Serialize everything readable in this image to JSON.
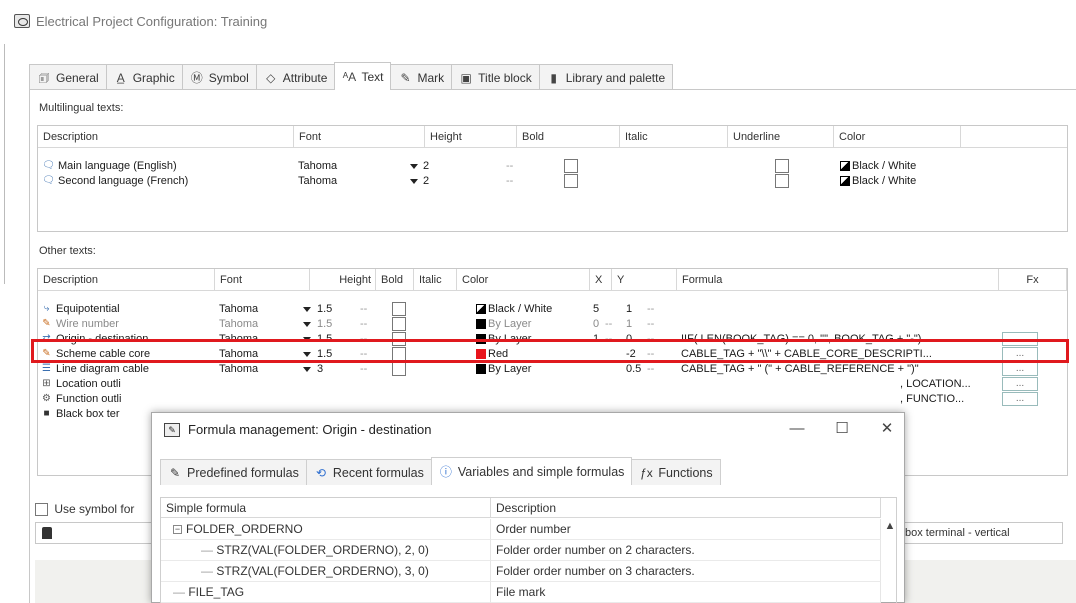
{
  "window": {
    "title": "Electrical Project Configuration: Training"
  },
  "tabs": [
    {
      "label": "General",
      "icon": "general-icon",
      "glyph": "🗊"
    },
    {
      "label": "Graphic",
      "icon": "graphic-icon",
      "glyph": "A̲"
    },
    {
      "label": "Symbol",
      "icon": "symbol-icon",
      "glyph": "Ⓜ"
    },
    {
      "label": "Attribute",
      "icon": "attribute-icon",
      "glyph": "◇"
    },
    {
      "label": "Text",
      "icon": "text-icon",
      "glyph": "ᴬA"
    },
    {
      "label": "Mark",
      "icon": "mark-icon",
      "glyph": "✎"
    },
    {
      "label": "Title block",
      "icon": "title-block-icon",
      "glyph": "▣"
    },
    {
      "label": "Library and palette",
      "icon": "library-icon",
      "glyph": "▮"
    }
  ],
  "multilingual": {
    "label": "Multilingual texts:",
    "headers": [
      "Description",
      "Font",
      "Height",
      "Bold",
      "Italic",
      "Underline",
      "Color"
    ],
    "rows": [
      {
        "desc": "Main language (English)",
        "font": "Tahoma",
        "height": "2",
        "dash": "--",
        "color": "Black / White"
      },
      {
        "desc": "Second language (French)",
        "font": "Tahoma",
        "height": "2",
        "dash": "--",
        "color": "Black / White"
      }
    ]
  },
  "other": {
    "label": "Other texts:",
    "headers": [
      "Description",
      "Font",
      "Height",
      "Bold",
      "Italic",
      "Color",
      "X",
      "Y",
      "Formula",
      "Fx"
    ],
    "rows": [
      {
        "desc": "Equipotential",
        "font": "Tahoma",
        "height": "1.5",
        "hdash": "--",
        "color": "Black / White",
        "swatch": "bw",
        "x": "5",
        "xdash": "",
        "y": "1",
        "ydash": "--",
        "formula": "",
        "fx": ""
      },
      {
        "desc": "Wire number",
        "font": "Tahoma",
        "height": "1.5",
        "hdash": "--",
        "color": "By Layer",
        "swatch": "blk",
        "x": "0",
        "xdash": "--",
        "y": "1",
        "ydash": "--",
        "formula": "",
        "fx": "",
        "dim": true
      },
      {
        "desc": "Origin - destination",
        "font": "Tahoma",
        "height": "1.5",
        "hdash": "--",
        "color": "By Layer",
        "swatch": "blk",
        "x": "1",
        "xdash": "--",
        "y": "0",
        "ydash": "--",
        "formula": "IIF( LEN(BOOK_TAG) == 0, \"\", BOOK_TAG + \"-\")...",
        "fx": "..."
      },
      {
        "desc": "Scheme cable core",
        "font": "Tahoma",
        "height": "1.5",
        "hdash": "--",
        "color": "Red",
        "swatch": "red",
        "x": "",
        "xdash": "",
        "y": "-2",
        "ydash": "--",
        "formula": "CABLE_TAG + \"\\\\\" + CABLE_CORE_DESCRIPTI...",
        "fx": "..."
      },
      {
        "desc": "Line diagram cable",
        "font": "Tahoma",
        "height": "3",
        "hdash": "--",
        "color": "By Layer",
        "swatch": "blk",
        "x": "",
        "xdash": "",
        "y": "0.5",
        "ydash": "--",
        "formula": "CABLE_TAG + \" (\" + CABLE_REFERENCE + \")\"",
        "fx": "..."
      },
      {
        "desc": "Location outli",
        "font": "",
        "height": "",
        "hdash": "",
        "color": "",
        "swatch": "",
        "x": "",
        "xdash": "",
        "y": "",
        "ydash": "",
        "formula": ", LOCATION...",
        "fx": "..."
      },
      {
        "desc": "Function outli",
        "font": "",
        "height": "",
        "hdash": "",
        "color": "",
        "swatch": "",
        "x": "",
        "xdash": "",
        "y": "",
        "ydash": "",
        "formula": ", FUNCTIO...",
        "fx": "..."
      },
      {
        "desc": "Black box ter",
        "font": "",
        "height": "",
        "hdash": "",
        "color": "",
        "swatch": "",
        "x": "",
        "xdash": "",
        "y": "",
        "ydash": "",
        "formula": "",
        "fx": ""
      }
    ]
  },
  "use_symbol_label": "Use symbol for",
  "right_combo_value": "box terminal - vertical",
  "dialog": {
    "title": "Formula management: Origin - destination",
    "min": "—",
    "max": "☐",
    "close": "✕",
    "tabs": [
      {
        "label": "Predefined formulas",
        "icon": "predefined-formulas-icon",
        "glyph": "✎"
      },
      {
        "label": "Recent formulas",
        "icon": "recent-formulas-icon",
        "glyph": "⟲"
      },
      {
        "label": "Variables and simple formulas",
        "icon": "info-icon",
        "glyph": "ⓘ"
      },
      {
        "label": "Functions",
        "icon": "functions-icon",
        "glyph": "ƒx"
      }
    ],
    "headers": [
      "Simple formula",
      "Description"
    ],
    "rows": [
      {
        "formula": "FOLDER_ORDERNO",
        "desc": "Order number",
        "level": 0,
        "expander": "−"
      },
      {
        "formula": "STRZ(VAL(FOLDER_ORDERNO), 2, 0)",
        "desc": "Folder order number on 2 characters.",
        "level": 1
      },
      {
        "formula": "STRZ(VAL(FOLDER_ORDERNO), 3, 0)",
        "desc": "Folder order number on 3 characters.",
        "level": 1
      },
      {
        "formula": "FILE_TAG",
        "desc": "File mark",
        "level": 0
      }
    ]
  },
  "colors": {
    "highlight": "#e0191e",
    "red_swatch": "#e8141c"
  }
}
